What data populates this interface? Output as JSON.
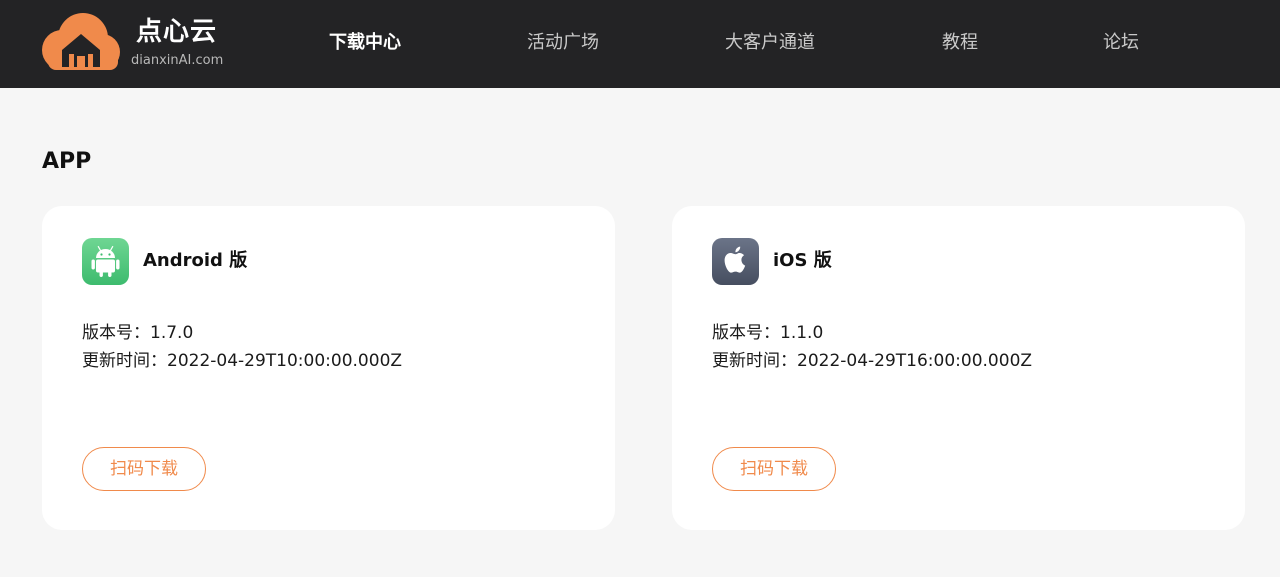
{
  "brand": {
    "name": "点心云",
    "domain": "dianxinAI.com",
    "accent": "#f08a4b"
  },
  "nav": {
    "items": [
      {
        "label": "下载中心",
        "active": true
      },
      {
        "label": "活动广场",
        "active": false
      },
      {
        "label": "大客户通道",
        "active": false
      },
      {
        "label": "教程",
        "active": false
      },
      {
        "label": "论坛",
        "active": false
      }
    ]
  },
  "main": {
    "section_title": "APP",
    "cards": [
      {
        "icon": "android-icon",
        "icon_color": "#3dbb6e",
        "title": "Android 版",
        "version": "版本号：1.7.0",
        "updated": "更新时间：2022-04-29T10:00:00.000Z",
        "button": "扫码下载"
      },
      {
        "icon": "apple-icon",
        "icon_color": "#4c5566",
        "title": "iOS 版",
        "version": "版本号：1.1.0",
        "updated": "更新时间：2022-04-29T16:00:00.000Z",
        "button": "扫码下载"
      }
    ]
  }
}
